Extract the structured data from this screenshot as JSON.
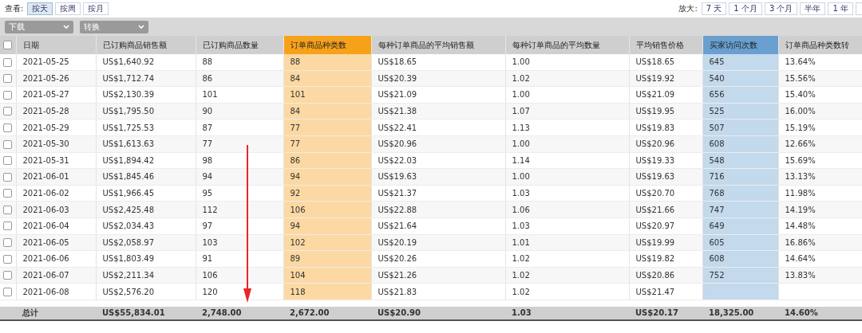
{
  "view": {
    "label": "查看:",
    "options": [
      {
        "label": "按天",
        "selected": true
      },
      {
        "label": "按周",
        "selected": false
      },
      {
        "label": "按月",
        "selected": false
      }
    ]
  },
  "zoom": {
    "label": "放大:",
    "options": [
      "7 天",
      "1 个月",
      "3 个月",
      "半年",
      "1 年"
    ]
  },
  "dropdowns": [
    "下载",
    "转换"
  ],
  "table": {
    "select_all": {
      "checked": false
    },
    "columns": [
      {
        "label": "日期"
      },
      {
        "label": "已订购商品销售额"
      },
      {
        "label": "已订购商品数量"
      },
      {
        "label": "订单商品种类数",
        "color": "#f7a11a"
      },
      {
        "label": "每种订单商品的平均销售额"
      },
      {
        "label": "每种订单商品的平均数量"
      },
      {
        "label": "平均销售价格"
      },
      {
        "label": "买家访问次数",
        "color": "#6a9fd0"
      },
      {
        "label": "订单商品种类数转"
      }
    ],
    "rows": [
      {
        "checked": false,
        "cells": [
          "2021-05-25",
          "US$1,640.92",
          "88",
          "88",
          "US$18.65",
          "1.00",
          "US$18.65",
          "645",
          "13.64%"
        ]
      },
      {
        "checked": false,
        "cells": [
          "2021-05-26",
          "US$1,712.74",
          "86",
          "84",
          "US$20.39",
          "1.02",
          "US$19.92",
          "540",
          "15.56%"
        ]
      },
      {
        "checked": false,
        "cells": [
          "2021-05-27",
          "US$2,130.39",
          "101",
          "101",
          "US$21.09",
          "1.00",
          "US$21.09",
          "656",
          "15.40%"
        ]
      },
      {
        "checked": false,
        "cells": [
          "2021-05-28",
          "US$1,795.50",
          "90",
          "84",
          "US$21.38",
          "1.07",
          "US$19.95",
          "525",
          "16.00%"
        ]
      },
      {
        "checked": false,
        "cells": [
          "2021-05-29",
          "US$1,725.53",
          "87",
          "77",
          "US$22.41",
          "1.13",
          "US$19.83",
          "507",
          "15.19%"
        ]
      },
      {
        "checked": false,
        "cells": [
          "2021-05-30",
          "US$1,613.63",
          "77",
          "77",
          "US$20.96",
          "1.00",
          "US$20.96",
          "608",
          "12.66%"
        ]
      },
      {
        "checked": false,
        "cells": [
          "2021-05-31",
          "US$1,894.42",
          "98",
          "86",
          "US$22.03",
          "1.14",
          "US$19.33",
          "548",
          "15.69%"
        ]
      },
      {
        "checked": false,
        "cells": [
          "2021-06-01",
          "US$1,845.46",
          "94",
          "94",
          "US$19.63",
          "1.00",
          "US$19.63",
          "716",
          "13.13%"
        ]
      },
      {
        "checked": false,
        "cells": [
          "2021-06-02",
          "US$1,966.45",
          "95",
          "92",
          "US$21.37",
          "1.03",
          "US$20.70",
          "768",
          "11.98%"
        ]
      },
      {
        "checked": false,
        "cells": [
          "2021-06-03",
          "US$2,425.48",
          "112",
          "106",
          "US$22.88",
          "1.06",
          "US$21.66",
          "747",
          "14.19%"
        ]
      },
      {
        "checked": false,
        "cells": [
          "2021-06-04",
          "US$2,034.43",
          "97",
          "94",
          "US$21.64",
          "1.03",
          "US$20.97",
          "649",
          "14.48%"
        ]
      },
      {
        "checked": false,
        "cells": [
          "2021-06-05",
          "US$2,058.97",
          "103",
          "102",
          "US$20.19",
          "1.01",
          "US$19.99",
          "605",
          "16.86%"
        ]
      },
      {
        "checked": false,
        "cells": [
          "2021-06-06",
          "US$1,803.49",
          "91",
          "89",
          "US$20.26",
          "1.02",
          "US$19.82",
          "608",
          "14.64%"
        ]
      },
      {
        "checked": false,
        "cells": [
          "2021-06-07",
          "US$2,211.34",
          "106",
          "104",
          "US$21.26",
          "1.02",
          "US$20.86",
          "752",
          "13.83%"
        ]
      },
      {
        "checked": false,
        "cells": [
          "2021-06-08",
          "US$2,576.20",
          "120",
          "118",
          "US$21.83",
          "1.02",
          "US$21.47"
        ]
      }
    ],
    "total": [
      "总计",
      "US$55,834.01",
      "2,748.00",
      "2,672.00",
      "US$20.90",
      "1.03",
      "US$20.17",
      "18,325.00",
      "14.60%"
    ]
  }
}
